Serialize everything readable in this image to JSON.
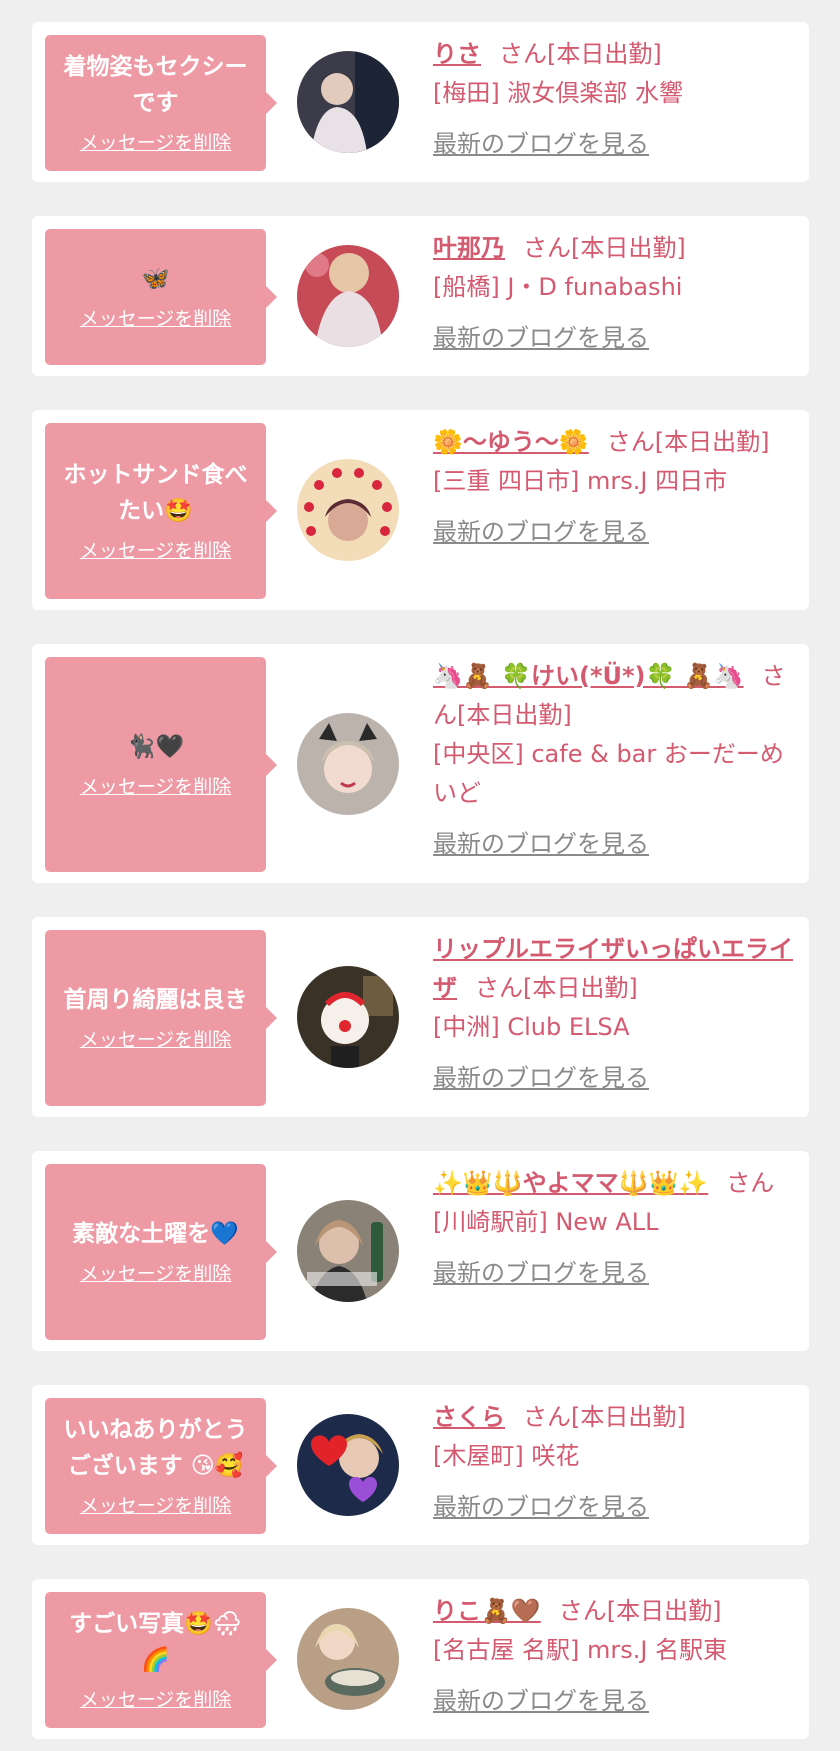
{
  "delete_label": "メッセージを削除",
  "blog_label": "最新のブログを見る",
  "colors": {
    "background": "#efefef",
    "card": "#ffffff",
    "bubble": "#ee9aa5",
    "accent_text": "#d45a70",
    "link_gray": "#8a8a8a"
  },
  "entries": [
    {
      "message": "着物姿もセクシーです",
      "name": "りさ",
      "honorific": "さん[本日出勤]",
      "store": "[梅田] 淑女倶楽部 水響",
      "avatar_icon": "photo-kimono-woman"
    },
    {
      "message": "🦋",
      "name": "叶那乃",
      "honorific": "さん[本日出勤]",
      "store": "[船橋] J・D funabashi",
      "avatar_icon": "photo-blurred-woman"
    },
    {
      "message": "ホットサンド食べたい🤩",
      "name": "🌼〜ゆう〜🌼",
      "honorific": "さん[本日出勤]",
      "store": "[三重 四日市] mrs.J 四日市",
      "avatar_icon": "photo-strawberry-frame"
    },
    {
      "message": "🐈‍⬛🖤",
      "name": "🦄🧸 🍀けい(*Ü*)🍀 🧸🦄",
      "honorific": "さん[本日出勤]",
      "store": "[中央区] cafe & bar おーだーめいど",
      "avatar_icon": "photo-cat-ears-girl"
    },
    {
      "message": "首周り綺麗は良き",
      "name": "リップルエライザいっぱいエライザ",
      "honorific": "さん[本日出勤]",
      "store": "[中洲] Club ELSA",
      "avatar_icon": "photo-clown-mask"
    },
    {
      "message": "素敵な土曜を💙",
      "name": "✨👑🔱やよママ🔱👑✨",
      "honorific": "さん",
      "store": "[川崎駅前] New ALL",
      "avatar_icon": "photo-woman-with-bottle"
    },
    {
      "message": "いいねありがとうございます 😘🥰",
      "name": "さくら",
      "honorific": "さん[本日出勤]",
      "store": "[木屋町] 咲花",
      "avatar_icon": "photo-hearts-selfie"
    },
    {
      "message": "すごい写真🤩🌧🌈",
      "name": "りこ🧸🤎",
      "honorific": "さん[本日出勤]",
      "store": "[名古屋 名駅] mrs.J 名駅東",
      "avatar_icon": "photo-woman-with-bowl"
    }
  ]
}
